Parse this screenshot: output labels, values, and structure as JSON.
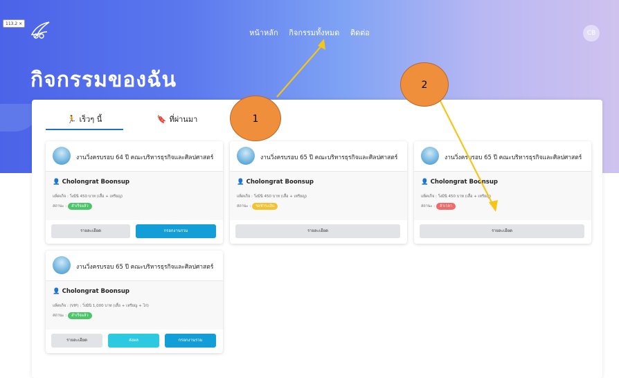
{
  "zoom_label": "113.2 ×",
  "nav": {
    "items": [
      "หน้าหลัก",
      "กิจกรรมทั้งหมด",
      "ติดต่อ"
    ]
  },
  "avatar_initials": "CB",
  "page_title": "กิจกรรมของฉัน",
  "tabs": [
    {
      "label": "เร็วๆ นี้",
      "icon": "running-person-icon",
      "active": true
    },
    {
      "label": "ที่ผ่านมา",
      "icon": "bookmark-icon",
      "active": false
    }
  ],
  "cards": [
    {
      "title": "งานวิ่งครบรอบ 64 ปี คณะบริหารธุรกิจและศิลปศาสตร์",
      "owner": "Cholongrat Boonsup",
      "package": "แพ็คเก็จ : วิ่งมินิ 450 บาท (เสื้อ + เหรียญ)",
      "status_label": "สถานะ :",
      "status": "สำเร็จแล้ว",
      "status_color": "#4bc56a",
      "buttons": [
        "รายละเอียด",
        "กรอกงานรวม"
      ]
    },
    {
      "title": "งานวิ่งครบรอบ 65 ปี คณะบริหารธุรกิจและศิลปศาสตร์",
      "owner": "Cholongrat Boonsup",
      "package": "แพ็คเก็จ : วิ่งมินิ 450 บาท (เสื้อ + เหรียญ)",
      "status_label": "สถานะ :",
      "status": "รอชำระเงิน",
      "status_color": "#f2c230",
      "buttons": [
        "รายละเอียด"
      ]
    },
    {
      "title": "งานวิ่งครบรอบ 65 ปี คณะบริหารธุรกิจและศิลปศาสตร์",
      "owner": "Cholongrat Boonsup",
      "package": "แพ็คเก็จ : วิ่งมินิ 450 บาท (เสื้อ + เหรียญ)",
      "status_label": "สถานะ :",
      "status": "ล้าเวลา",
      "status_color": "#f06a6a",
      "buttons": [
        "รายละเอียด"
      ]
    },
    {
      "title": "งานวิ่งครบรอบ 65 ปี คณะบริหารธุรกิจและศิลปศาสตร์",
      "owner": "Cholongrat Boonsup",
      "package": "แพ็คเก็จ : (VIP) : วิ่งมินิ 1,000 บาท (เสื้อ + เหรียญ + ไก่)",
      "status_label": "สถานะ :",
      "status": "สำเร็จแล้ว",
      "status_color": "#4bc56a",
      "buttons": [
        "รายละเอียด",
        "ส่งผล",
        "กรอกงานรวม"
      ]
    }
  ],
  "callouts": [
    "1",
    "2"
  ],
  "colors": {
    "accent_blue": "#139ed8",
    "arrow": "#f5c518",
    "callout_fill": "#f08f3b"
  }
}
